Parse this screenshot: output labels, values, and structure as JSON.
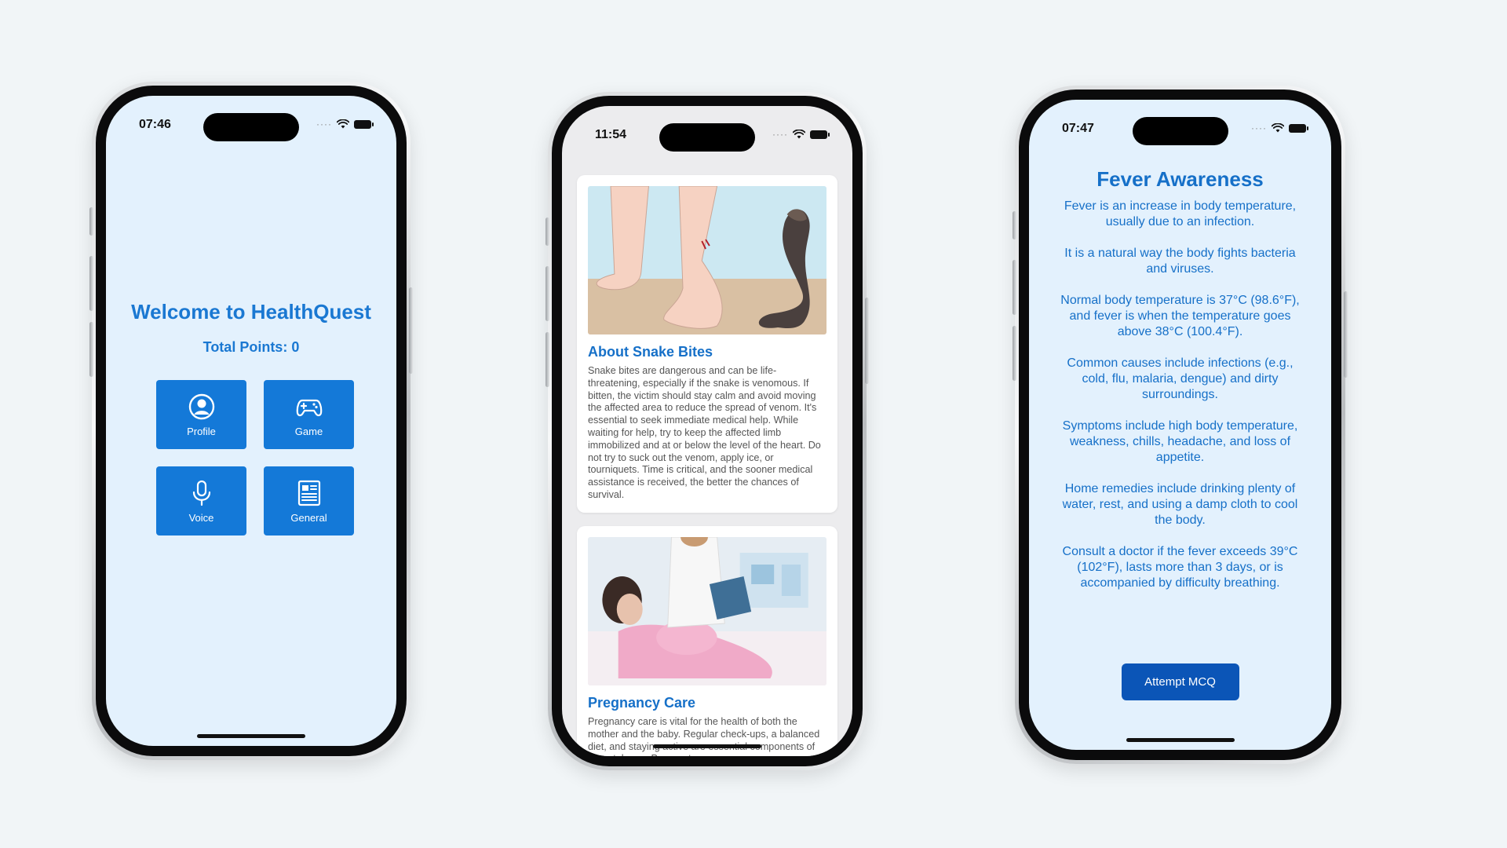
{
  "colors": {
    "background": "#f1f5f7",
    "screen_light_blue": "#e3f1fd",
    "primary_blue": "#1479d8",
    "title_blue": "#1670c8",
    "button_dark_blue": "#0b55b7"
  },
  "phones": [
    {
      "status_time": "07:46",
      "app": {
        "title": "Welcome to HealthQuest",
        "points_text": "Total Points: 0",
        "tiles": [
          {
            "label": "Profile",
            "icon": "person-circle-icon"
          },
          {
            "label": "Game",
            "icon": "gamepad-icon"
          },
          {
            "label": "Voice",
            "icon": "microphone-icon"
          },
          {
            "label": "General",
            "icon": "newspaper-icon"
          }
        ]
      }
    },
    {
      "status_time": "11:54",
      "articles": [
        {
          "image": "snake-bite-illustration",
          "title": "About Snake Bites",
          "body": "Snake bites are dangerous and can be life-threatening, especially if the snake is venomous. If bitten, the victim should stay calm and avoid moving the affected area to reduce the spread of venom. It's essential to seek immediate medical help. While waiting for help, try to keep the affected limb immobilized and at or below the level of the heart. Do not try to suck out the venom, apply ice, or tourniquets. Time is critical, and the sooner medical assistance is received, the better the chances of survival."
        },
        {
          "image": "pregnancy-care-photo",
          "title": "Pregnancy Care",
          "body": "Pregnancy care is vital for the health of both the mother and the baby. Regular check-ups, a balanced diet, and staying active are essential components of prenatal care. Pregnant women"
        }
      ]
    },
    {
      "status_time": "07:47",
      "fever": {
        "title": "Fever Awareness",
        "paragraphs": [
          "Fever is an increase in body temperature, usually due to an infection.",
          "It is a natural way the body fights bacteria and viruses.",
          "Normal body temperature is 37°C (98.6°F), and fever is when the temperature goes above 38°C (100.4°F).",
          "Common causes include infections (e.g., cold, flu, malaria, dengue) and dirty surroundings.",
          "Symptoms include high body temperature, weakness, chills, headache, and loss of appetite.",
          "Home remedies include drinking plenty of water, rest, and using a damp cloth to cool the body.",
          "Consult a doctor if the fever exceeds 39°C (102°F), lasts more than 3 days, or is accompanied by difficulty breathing."
        ],
        "button_label": "Attempt MCQ"
      }
    }
  ]
}
